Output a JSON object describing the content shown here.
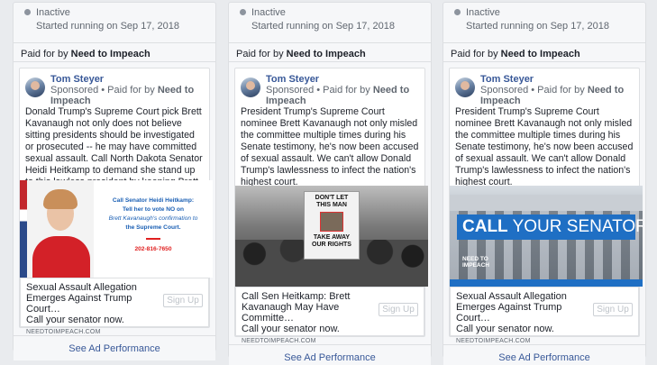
{
  "cards": [
    {
      "status": "Inactive",
      "started": "Started running on Sep 17, 2018",
      "paid_prefix": "Paid for by ",
      "paid_by": "Need to Impeach",
      "advertiser": "Tom Steyer",
      "sponsored": "Sponsored",
      "sponsored_paid": " • Paid for by ",
      "sponsored_org": "Need to Impeach",
      "copy": "Donald Trump's Supreme Court pick Brett Kavanaugh not only does not believe sitting presidents should be investigated or prosecuted -- he may have committed sexual assault. Call North Dakota Senator Heidi Heitkamp to demand she stand up to this lawless president by keeping Brett Kavanaugh off the Supreme…",
      "image_lines": [
        "Call Senator Heidi Heitkamp:",
        "Tell her to vote NO on",
        "Brett Kavanaugh's confirmation to",
        "the Supreme Court."
      ],
      "image_phone": "202-816-7650",
      "link_title": "Sexual Assault Allegation Emerges Against Trump Court…",
      "link_desc": "Call your senator now.",
      "link_url": "NEEDTOIMPEACH.COM",
      "cta": "Sign Up",
      "perf": "See Ad Performance"
    },
    {
      "status": "Inactive",
      "started": "Started running on Sep 17, 2018",
      "paid_prefix": "Paid for by ",
      "paid_by": "Need to Impeach",
      "advertiser": "Tom Steyer",
      "sponsored": "Sponsored",
      "sponsored_paid": " • Paid for by ",
      "sponsored_org": "Need to Impeach",
      "copy": "President Trump's Supreme Court nominee Brett Kavanaugh not only misled the committee multiple times during his Senate testimony, he's now been accused of sexual assault. We can't allow Donald Trump's lawlessness to infect the nation's highest court.",
      "ellipsis": "...",
      "sign_top": "DON'T LET THIS MAN",
      "sign_bottom": "TAKE AWAY OUR RIGHTS",
      "link_title": "Call Sen Heitkamp: Brett Kavanaugh May Have Committe…",
      "link_desc": "Call your senator now.",
      "link_url": "NEEDTOIMPEACH.COM",
      "cta": "Sign Up",
      "perf": "See Ad Performance"
    },
    {
      "status": "Inactive",
      "started": "Started running on Sep 17, 2018",
      "paid_prefix": "Paid for by ",
      "paid_by": "Need to Impeach",
      "advertiser": "Tom Steyer",
      "sponsored": "Sponsored",
      "sponsored_paid": " • Paid for by ",
      "sponsored_org": "Need to Impeach",
      "copy": "President Trump's Supreme Court nominee Brett Kavanaugh not only misled the committee multiple times during his Senate testimony, he's now been accused of sexual assault. We can't allow Donald Trump's lawlessness to infect the nation's highest court.",
      "ellipsis": "...",
      "banner_bold": "CALL",
      "banner_rest": " YOUR SENATOR",
      "logo_line1": "NEED TO",
      "logo_line2": "IMPEACH",
      "link_title": "Sexual Assault Allegation Emerges Against Trump Court…",
      "link_desc": "Call your senator now.",
      "link_url": "NEEDTOIMPEACH.COM",
      "cta": "Sign Up",
      "perf": "See Ad Performance"
    }
  ],
  "colors": {
    "link_blue": "#385898",
    "banner_blue": "#1f6fc4",
    "heitkamp_blue": "#1a5fb4",
    "red": "#e02020"
  }
}
